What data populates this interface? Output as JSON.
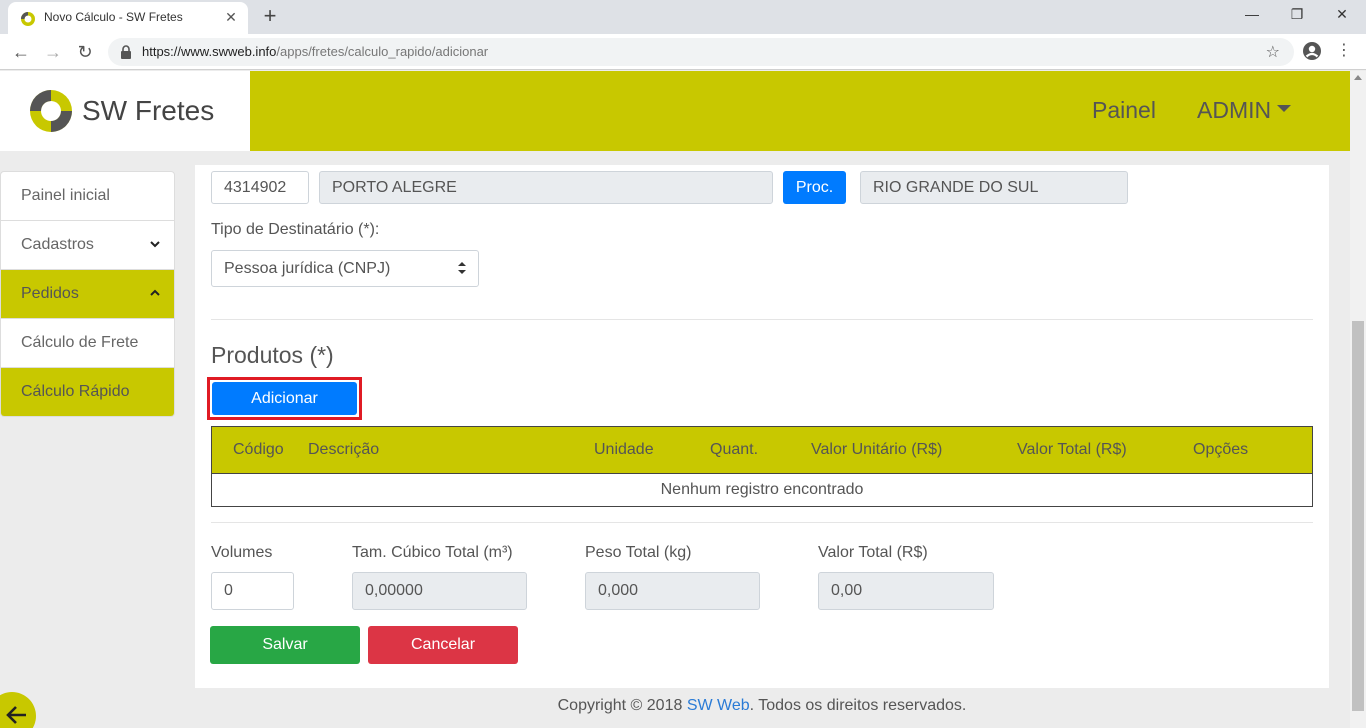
{
  "browser": {
    "tab_title": "Novo Cálculo - SW Fretes",
    "url_host": "https://www.swweb.info",
    "url_path": "/apps/fretes/calculo_rapido/adicionar"
  },
  "header": {
    "brand": "SW Fretes",
    "nav_painel": "Painel",
    "nav_admin": "ADMIN",
    "accent_color": "#c8c800"
  },
  "sidebar": {
    "items": [
      {
        "label": "Painel inicial"
      },
      {
        "label": "Cadastros"
      },
      {
        "label": "Pedidos"
      },
      {
        "label": "Cálculo de Frete"
      },
      {
        "label": "Cálculo Rápido"
      }
    ]
  },
  "address": {
    "ibge_code": "4314902",
    "city": "PORTO ALEGRE",
    "proc_button": "Proc.",
    "state": "RIO GRANDE DO SUL"
  },
  "recipient": {
    "label": "Tipo de Destinatário (*):",
    "selected": "Pessoa jurídica (CNPJ)"
  },
  "products": {
    "title": "Produtos (*)",
    "add_button": "Adicionar",
    "columns": [
      "Código",
      "Descrição",
      "Unidade",
      "Quant.",
      "Valor Unitário (R$)",
      "Valor Total (R$)",
      "Opções"
    ],
    "empty_message": "Nenhum registro encontrado"
  },
  "totals": {
    "volumes_label": "Volumes",
    "volumes_value": "0",
    "cubic_label": "Tam. Cúbico Total (m³)",
    "cubic_value": "0,00000",
    "weight_label": "Peso Total (kg)",
    "weight_value": "0,000",
    "value_label": "Valor Total (R$)",
    "value_value": "0,00"
  },
  "actions": {
    "save": "Salvar",
    "cancel": "Cancelar",
    "save_color": "#28a745",
    "cancel_color": "#dc3545",
    "primary_color": "#007bff"
  },
  "footer": {
    "prefix": "Copyright © 2018 ",
    "link": "SW Web",
    "suffix": ". Todos os direitos reservados."
  }
}
